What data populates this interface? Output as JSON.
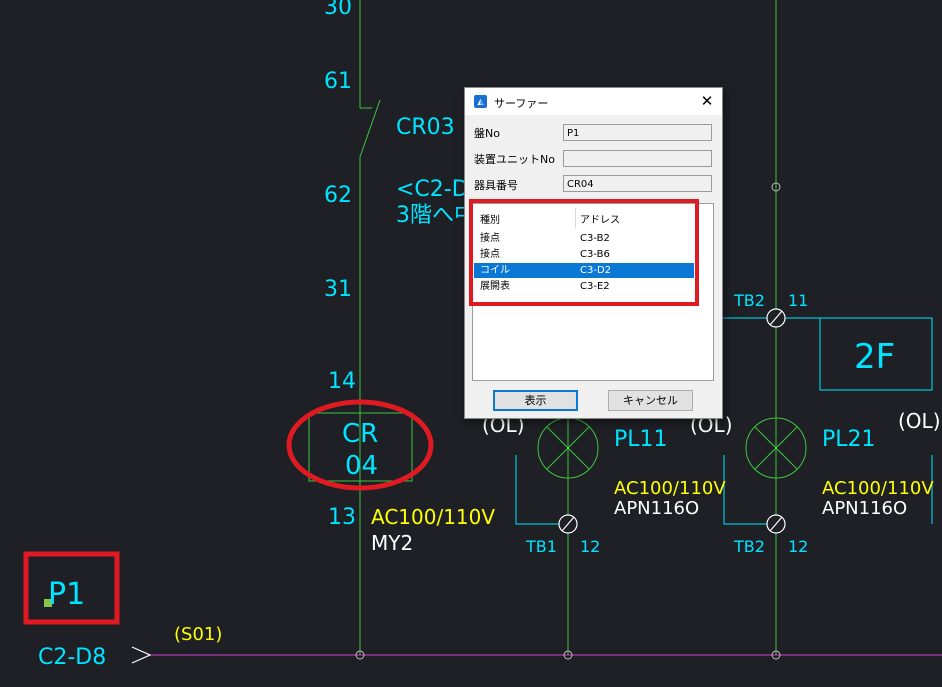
{
  "drawing": {
    "wire_numbers": [
      "30",
      "61",
      "62",
      "31",
      "14",
      "13"
    ],
    "contact_label": "CR03",
    "note_line1": "<C2-D",
    "note_line2": "3階へ中",
    "coil_line1": "CR",
    "coil_line2": "04",
    "coil_voltage": "AC100/110V",
    "coil_model": "MY2",
    "panel_label": "P1",
    "ref_label": "C2-D8",
    "line_label": "(S01)",
    "lamp1": {
      "name": "PL11",
      "voltage": "AC100/110V",
      "model": "APN116O",
      "ol_label": "(OL)"
    },
    "lamp2": {
      "name": "PL21",
      "voltage": "AC100/110V",
      "model": "APN116O",
      "ol_label": "(OL)"
    },
    "ol_right": "(OL)",
    "tb_labels": [
      "TB2",
      "11",
      "TB1",
      "12",
      "TB2",
      "12"
    ],
    "floor_label": "2F"
  },
  "colors": {
    "background": "#1e2026",
    "wire_green": "#3ec43e",
    "wire_magenta": "#d040d0",
    "text_cyan": "#00e5ff",
    "text_yellow": "#ffff00",
    "text_white": "#ffffff",
    "highlight_red": "#e01a22",
    "selection_blue": "#0a78d4"
  },
  "dialog": {
    "title": "サーファー",
    "fields": [
      {
        "label": "盤No",
        "value": "P1"
      },
      {
        "label": "装置ユニットNo",
        "value": ""
      },
      {
        "label": "器具番号",
        "value": "CR04"
      }
    ],
    "list_headers": [
      "種別",
      "アドレス"
    ],
    "rows": [
      {
        "type": "接点",
        "address": "C3-B2",
        "selected": false
      },
      {
        "type": "接点",
        "address": "C3-B6",
        "selected": false
      },
      {
        "type": "コイル",
        "address": "C3-D2",
        "selected": true
      },
      {
        "type": "展開表",
        "address": "C3-E2",
        "selected": false
      }
    ],
    "ok_label": "表示",
    "cancel_label": "キャンセル",
    "close_icon": "close-icon",
    "app_icon": "app-logo-icon"
  }
}
